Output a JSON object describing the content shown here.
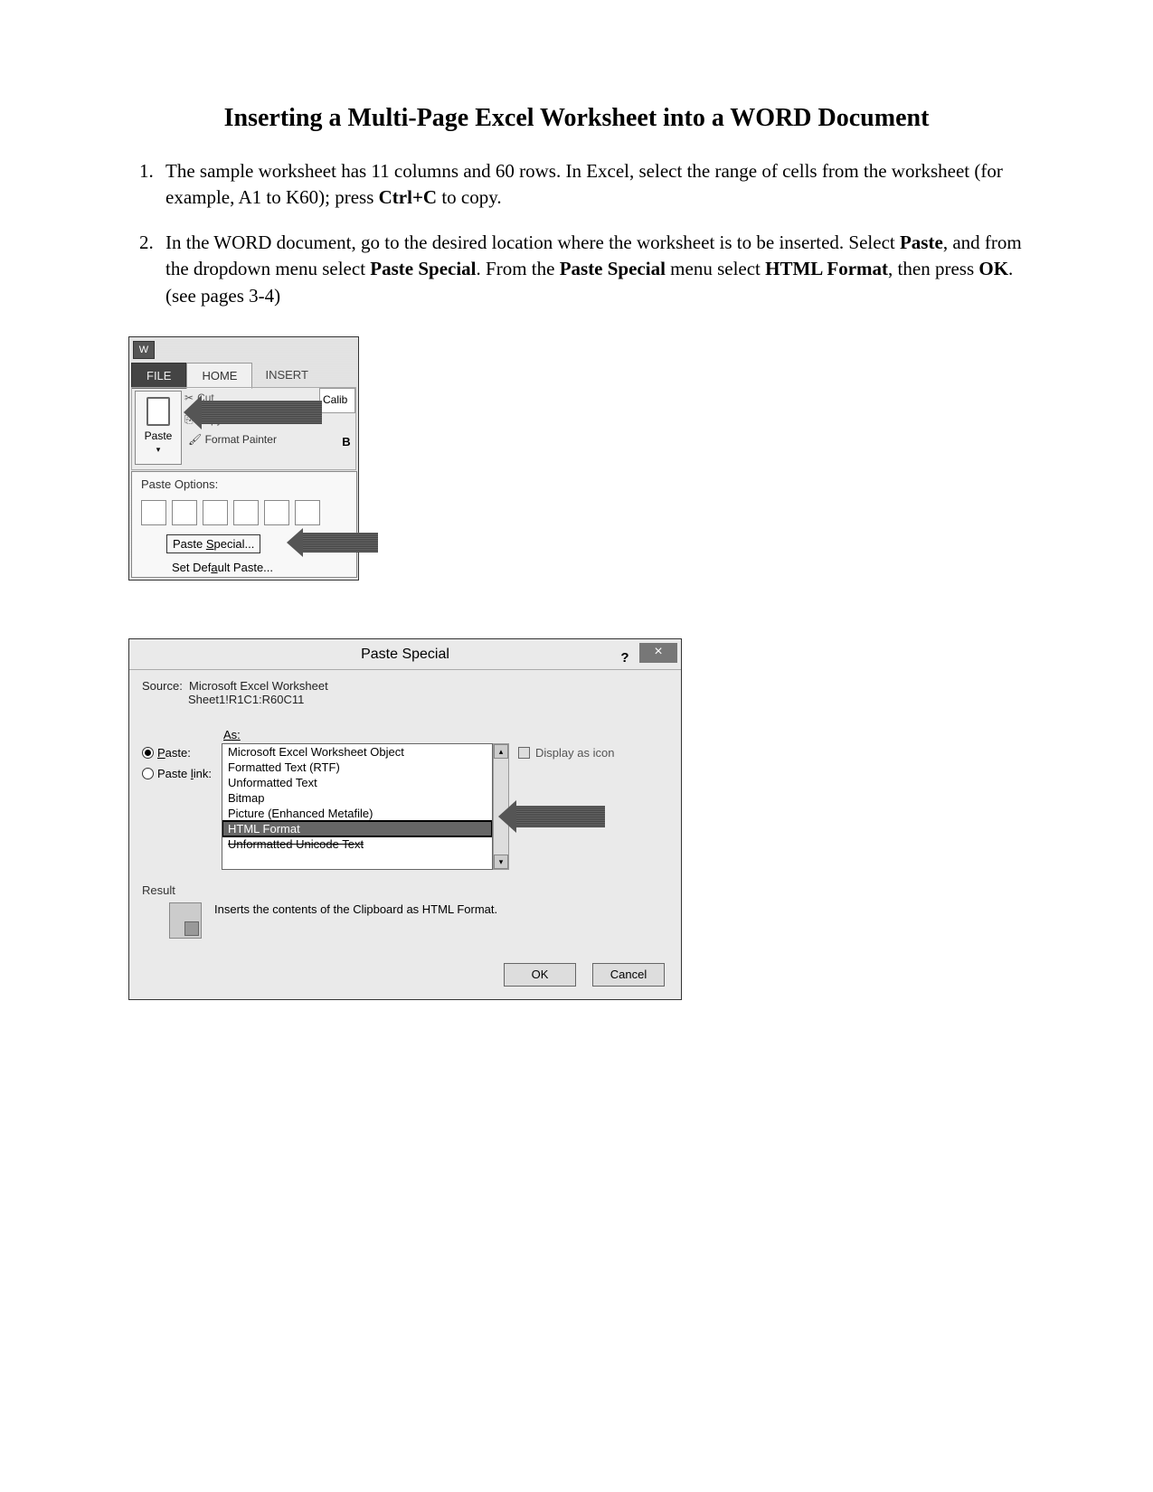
{
  "title": "Inserting a Multi-Page Excel Worksheet into a WORD Document",
  "steps": {
    "s1_a": "The sample worksheet has 11 columns and 60 rows. In Excel, select the range of cells from the worksheet (for example, A1 to K60); press ",
    "s1_b": "Ctrl+C",
    "s1_c": " to copy.",
    "s2_a": "In the WORD document, go to the desired location where the worksheet is to be inserted. Select ",
    "s2_b": "Paste",
    "s2_c": ", and from the dropdown menu select ",
    "s2_d": "Paste Special",
    "s2_e": ". From the ",
    "s2_f": "Paste Special",
    "s2_g": " menu select ",
    "s2_h": "HTML Format",
    "s2_i": ", then press ",
    "s2_j": "OK",
    "s2_k": ". (see pages 3-4)"
  },
  "ribbon": {
    "tabs": {
      "file": "FILE",
      "home": "HOME",
      "insert": "INSERT"
    },
    "paste": "Paste",
    "cut": "Cut",
    "copy": "Copy",
    "format_painter": "Format Painter",
    "font_preview": "Calib",
    "bold": "B",
    "menu_title": "Paste Options:",
    "paste_special": "Paste Special...",
    "set_default": "Set Default Paste..."
  },
  "dialog": {
    "title": "Paste Special",
    "source_label": "Source:",
    "source_value": "Microsoft Excel Worksheet",
    "source_detail": "Sheet1!R1C1:R60C11",
    "as_label": "As:",
    "paste_radio": "Paste:",
    "paste_link_radio": "Paste link:",
    "options": {
      "o0": "Microsoft Excel Worksheet Object",
      "o1": "Formatted Text (RTF)",
      "o2": "Unformatted Text",
      "o3": "Bitmap",
      "o4": "Picture (Enhanced Metafile)",
      "o5": "HTML Format",
      "o6": "Unformatted Unicode Text"
    },
    "display_as_icon": "Display as icon",
    "result_label": "Result",
    "result_text": "Inserts the contents of the Clipboard as HTML Format.",
    "ok": "OK",
    "cancel": "Cancel",
    "help": "?",
    "close": "×"
  }
}
